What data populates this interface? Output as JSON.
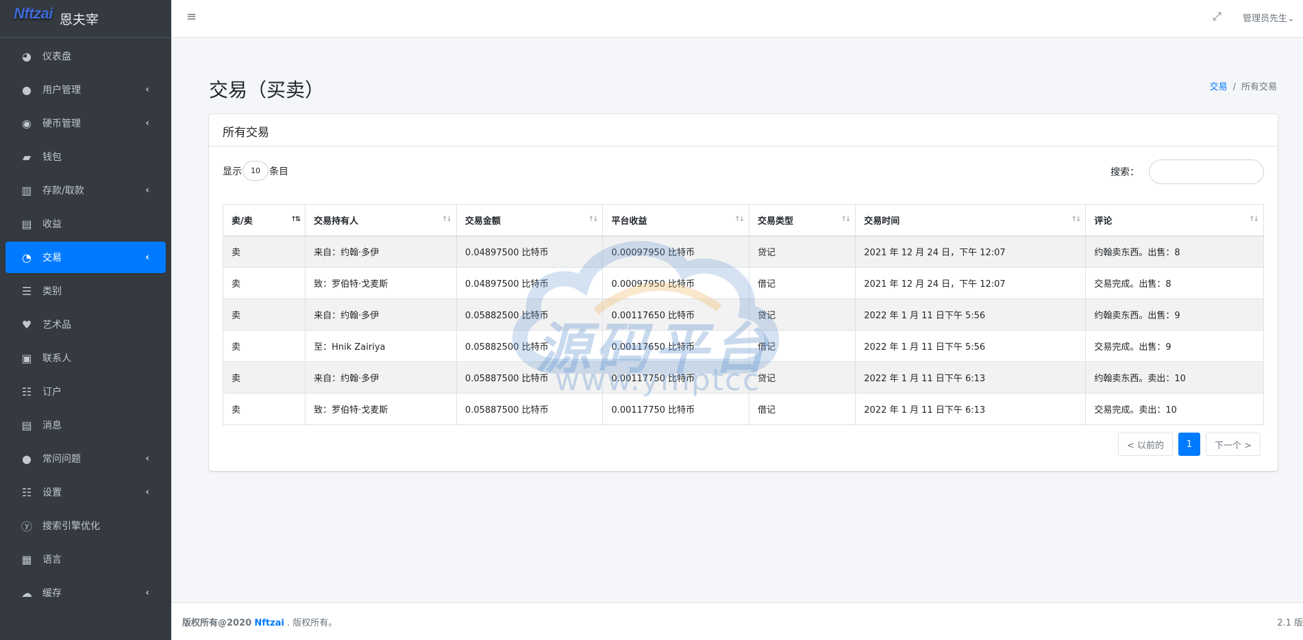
{
  "brand": {
    "logo": "Nftzai",
    "name": "恩夫宰"
  },
  "sidebar": {
    "items": [
      {
        "label": "仪表盘",
        "icon": "◕",
        "chevron": ""
      },
      {
        "label": "用户管理",
        "icon": "●",
        "chevron": "‹"
      },
      {
        "label": "硬币管理",
        "icon": "◉",
        "chevron": "‹"
      },
      {
        "label": "钱包",
        "icon": "▰",
        "chevron": ""
      },
      {
        "label": "存款/取款",
        "icon": "▥",
        "chevron": "‹"
      },
      {
        "label": "收益",
        "icon": "▤",
        "chevron": ""
      },
      {
        "label": "交易",
        "icon": "◔",
        "chevron": "‹"
      },
      {
        "label": "类别",
        "icon": "☰",
        "chevron": ""
      },
      {
        "label": "艺术品",
        "icon": "♥",
        "chevron": ""
      },
      {
        "label": "联系人",
        "icon": "▣",
        "chevron": ""
      },
      {
        "label": "订户",
        "icon": "☷",
        "chevron": ""
      },
      {
        "label": "消息",
        "icon": "▤",
        "chevron": ""
      },
      {
        "label": "常问问题",
        "icon": "●",
        "chevron": "‹"
      },
      {
        "label": "设置",
        "icon": "☷",
        "chevron": "‹"
      },
      {
        "label": "搜索引擎优化",
        "icon": "ⓨ",
        "chevron": ""
      },
      {
        "label": "语言",
        "icon": "▦",
        "chevron": ""
      },
      {
        "label": "缓存",
        "icon": "☁",
        "chevron": "‹"
      }
    ]
  },
  "header": {
    "menu_icon": "≡",
    "fullscreen_icon": "⤢",
    "user": "管理员先生",
    "user_chevron": "⌄"
  },
  "page": {
    "title": "交易（买卖）"
  },
  "breadcrumb": {
    "parent": "交易",
    "separator": "/",
    "current": "所有交易"
  },
  "card": {
    "title": "所有交易"
  },
  "table_controls": {
    "show_label": "显示",
    "entries_value": "10",
    "entries_label": "条目",
    "search_label": "搜索：",
    "search_value": ""
  },
  "table": {
    "headers": [
      "卖/卖",
      "交易持有人",
      "交易金额",
      "平台收益",
      "交易类型",
      "交易时间",
      "评论"
    ],
    "rows": [
      [
        "卖",
        "来自：约翰·多伊",
        "0.04897500 比特币",
        "0.00097950 比特币",
        "贷记",
        "2021 年 12 月 24 日，下午 12:07",
        "约翰卖东西。出售：8"
      ],
      [
        "卖",
        "致：罗伯特·戈麦斯",
        "0.04897500 比特币",
        "0.00097950 比特币",
        "借记",
        "2021 年 12 月 24 日，下午 12:07",
        "交易完成。出售：8"
      ],
      [
        "卖",
        "来自：约翰·多伊",
        "0.05882500 比特币",
        "0.00117650 比特币",
        "贷记",
        "2022 年 1 月 11 日下午 5:56",
        "约翰卖东西。出售：9"
      ],
      [
        "卖",
        "至：Hnik Zairiya",
        "0.05882500 比特币",
        "0.00117650 比特币",
        "借记",
        "2022 年 1 月 11 日下午 5:56",
        "交易完成。出售：9"
      ],
      [
        "卖",
        "来自：约翰·多伊",
        "0.05887500 比特币",
        "0.00117750 比特币",
        "贷记",
        "2022 年 1 月 11 日下午 6:13",
        "约翰卖东西。卖出：10"
      ],
      [
        "卖",
        "致：罗伯特·戈麦斯",
        "0.05887500 比特币",
        "0.00117750 比特币",
        "借记",
        "2022 年 1 月 11 日下午 6:13",
        "交易完成。卖出：10"
      ]
    ]
  },
  "pagination": {
    "prev": "< 以前的",
    "page": "1",
    "next": "下一个 >"
  },
  "watermark": {
    "text": "源码平台",
    "url": "www.ymptcc"
  },
  "footer": {
    "copyright": "版权所有@2020",
    "brand": "Nftzai",
    "suffix": ". 版权所有。",
    "version": "2.1 版"
  }
}
